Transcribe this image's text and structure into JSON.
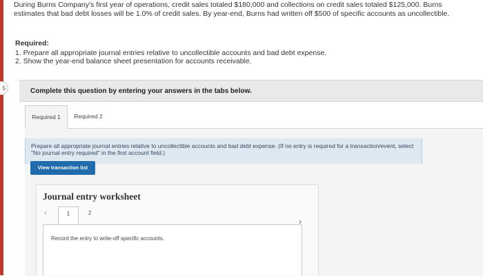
{
  "problem": {
    "text": "During Burns Company's first year of operations, credit sales totaled $180,000 and collections on credit sales totaled $125,000. Burns estimates that bad debt losses will be 1.0% of credit sales. By year-end, Burns had written off $500 of specific accounts as uncollectible."
  },
  "required": {
    "heading": "Required:",
    "items": [
      "1. Prepare all appropriate journal entries relative to uncollectible accounts and bad debt expense.",
      "2. Show the year-end balance sheet presentation for accounts receivable."
    ]
  },
  "side_tab": {
    "label": "5"
  },
  "banner": {
    "text": "Complete this question by entering your answers in the tabs below."
  },
  "tabs": [
    {
      "label": "Required 1",
      "active": true
    },
    {
      "label": "Required 2",
      "active": false
    }
  ],
  "instructions": {
    "text": "Prepare all appropriate journal entries relative to uncollectible accounts and bad debt expense. (If no entry is required for a transaction/event, select \"No journal entry required\" in the first account field.)"
  },
  "view_transaction_button": {
    "label": "View transaction list"
  },
  "worksheet": {
    "title": "Journal entry worksheet",
    "pages": [
      "1",
      "2"
    ],
    "current_page": "1",
    "prev_icon": "chevron-left-icon",
    "next_icon": "chevron-right-icon",
    "entry_description": "Record the entry to write-off specific accounts."
  },
  "colors": {
    "accent": "#c0392b",
    "button_blue": "#1f6bab",
    "instructions_bg": "#dde8f1",
    "banner_bg": "#e9e9e9"
  }
}
